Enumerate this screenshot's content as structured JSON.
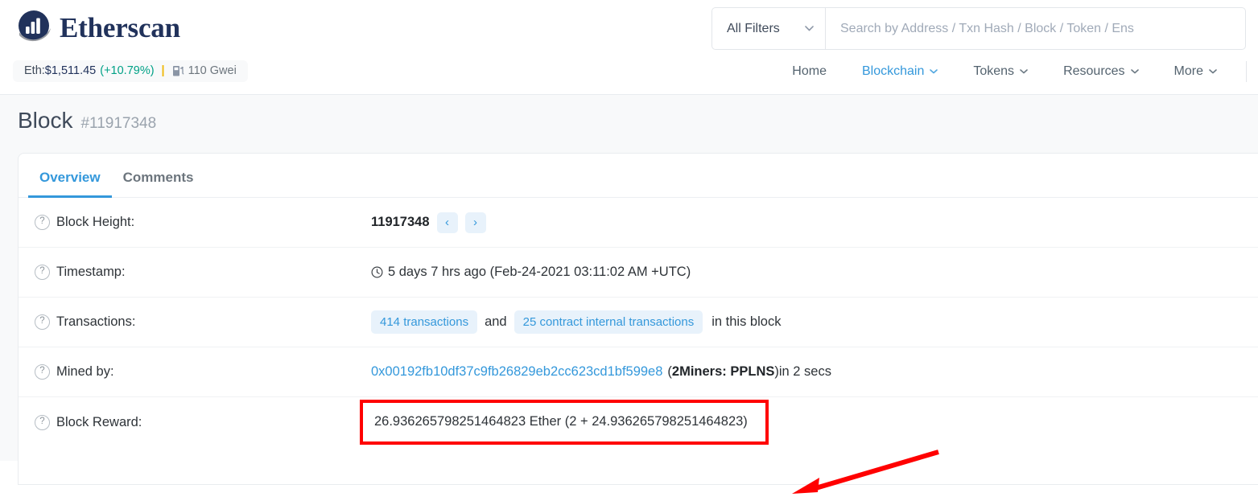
{
  "brand": {
    "name": "Etherscan",
    "logo_icon": "etherscan-logo-icon"
  },
  "ticker": {
    "eth_label": "Eth: ",
    "eth_price": "$1,511.45",
    "eth_change": "(+10.79%)",
    "separator": "|",
    "gas_icon": "gas-pump-icon",
    "gas_value": "110 Gwei"
  },
  "search": {
    "filter_label": "All Filters",
    "filter_caret_icon": "chevron-down-icon",
    "placeholder": "Search by Address / Txn Hash / Block / Token / Ens",
    "value": ""
  },
  "nav": {
    "items": [
      {
        "label": "Home",
        "has_caret": false,
        "active": false
      },
      {
        "label": "Blockchain",
        "has_caret": true,
        "active": true
      },
      {
        "label": "Tokens",
        "has_caret": true,
        "active": false
      },
      {
        "label": "Resources",
        "has_caret": true,
        "active": false
      },
      {
        "label": "More",
        "has_caret": true,
        "active": false
      }
    ]
  },
  "page": {
    "title": "Block",
    "subtitle": "#11917348"
  },
  "tabs": [
    {
      "label": "Overview",
      "active": true
    },
    {
      "label": "Comments",
      "active": false
    }
  ],
  "overview": {
    "block_height": {
      "label": "Block Height:",
      "value": "11917348",
      "prev_icon": "chevron-left-icon",
      "prev_glyph": "‹",
      "next_icon": "chevron-right-icon",
      "next_glyph": "›"
    },
    "timestamp": {
      "label": "Timestamp:",
      "clock_icon": "clock-icon",
      "value": "5 days 7 hrs ago (Feb-24-2021 03:11:02 AM +UTC)"
    },
    "transactions": {
      "label": "Transactions:",
      "txn_badge": "414 transactions",
      "conjunction": "and",
      "internal_badge": "25 contract internal transactions",
      "trailing": "in this block"
    },
    "mined_by": {
      "label": "Mined by:",
      "address": "0x00192fb10df37c9fb26829eb2cc623cd1bf599e8",
      "open_paren": "(",
      "miner_name": "2Miners: PPLNS",
      "close_paren": ")",
      "duration": " in 2 secs"
    },
    "block_reward": {
      "label": "Block Reward:",
      "value": "26.936265798251464823 Ether (2 + 24.936265798251464823)",
      "highlighted": true
    }
  },
  "annotations": {
    "arrow_icon": "red-arrow-icon",
    "highlight_color": "#ff0000"
  },
  "colors": {
    "brand_navy": "#21325b",
    "link_blue": "#3498db",
    "positive_green": "#00a186",
    "accent_yellow": "#f0b90b",
    "page_bg": "#f8f9fa"
  }
}
